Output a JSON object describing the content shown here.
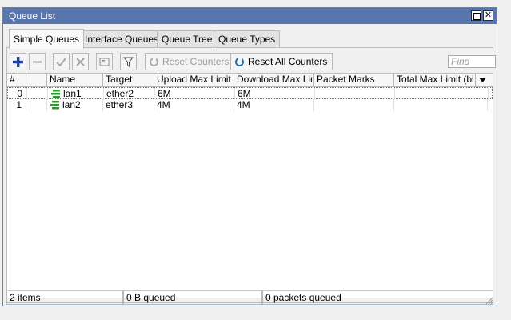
{
  "window": {
    "title": "Queue List"
  },
  "tabs": [
    {
      "label": "Simple Queues",
      "active": true
    },
    {
      "label": "Interface Queues",
      "active": false
    },
    {
      "label": "Queue Tree",
      "active": false
    },
    {
      "label": "Queue Types",
      "active": false
    }
  ],
  "toolbar": {
    "reset_counters_label": "Reset Counters",
    "reset_all_counters_label": "Reset All Counters",
    "find_placeholder": "Find"
  },
  "table": {
    "columns": [
      "#",
      "",
      "Name",
      "Target",
      "Upload Max Limit",
      "Download Max Limit",
      "Packet Marks",
      "Total Max Limit (bi..."
    ],
    "rows": [
      {
        "num": "0",
        "name": "lan1",
        "target": "ether2",
        "upload": "6M",
        "download": "6M",
        "marks": "",
        "total": ""
      },
      {
        "num": "1",
        "name": "lan2",
        "target": "ether3",
        "upload": "4M",
        "download": "4M",
        "marks": "",
        "total": ""
      }
    ]
  },
  "status": {
    "items": "2 items",
    "queued_bytes": "0 B queued",
    "queued_packets": "0 packets queued"
  },
  "colors": {
    "title_bar": "#5876ad",
    "queue_icon": "#2a9a2a",
    "add_icon": "#1f3f9a"
  }
}
